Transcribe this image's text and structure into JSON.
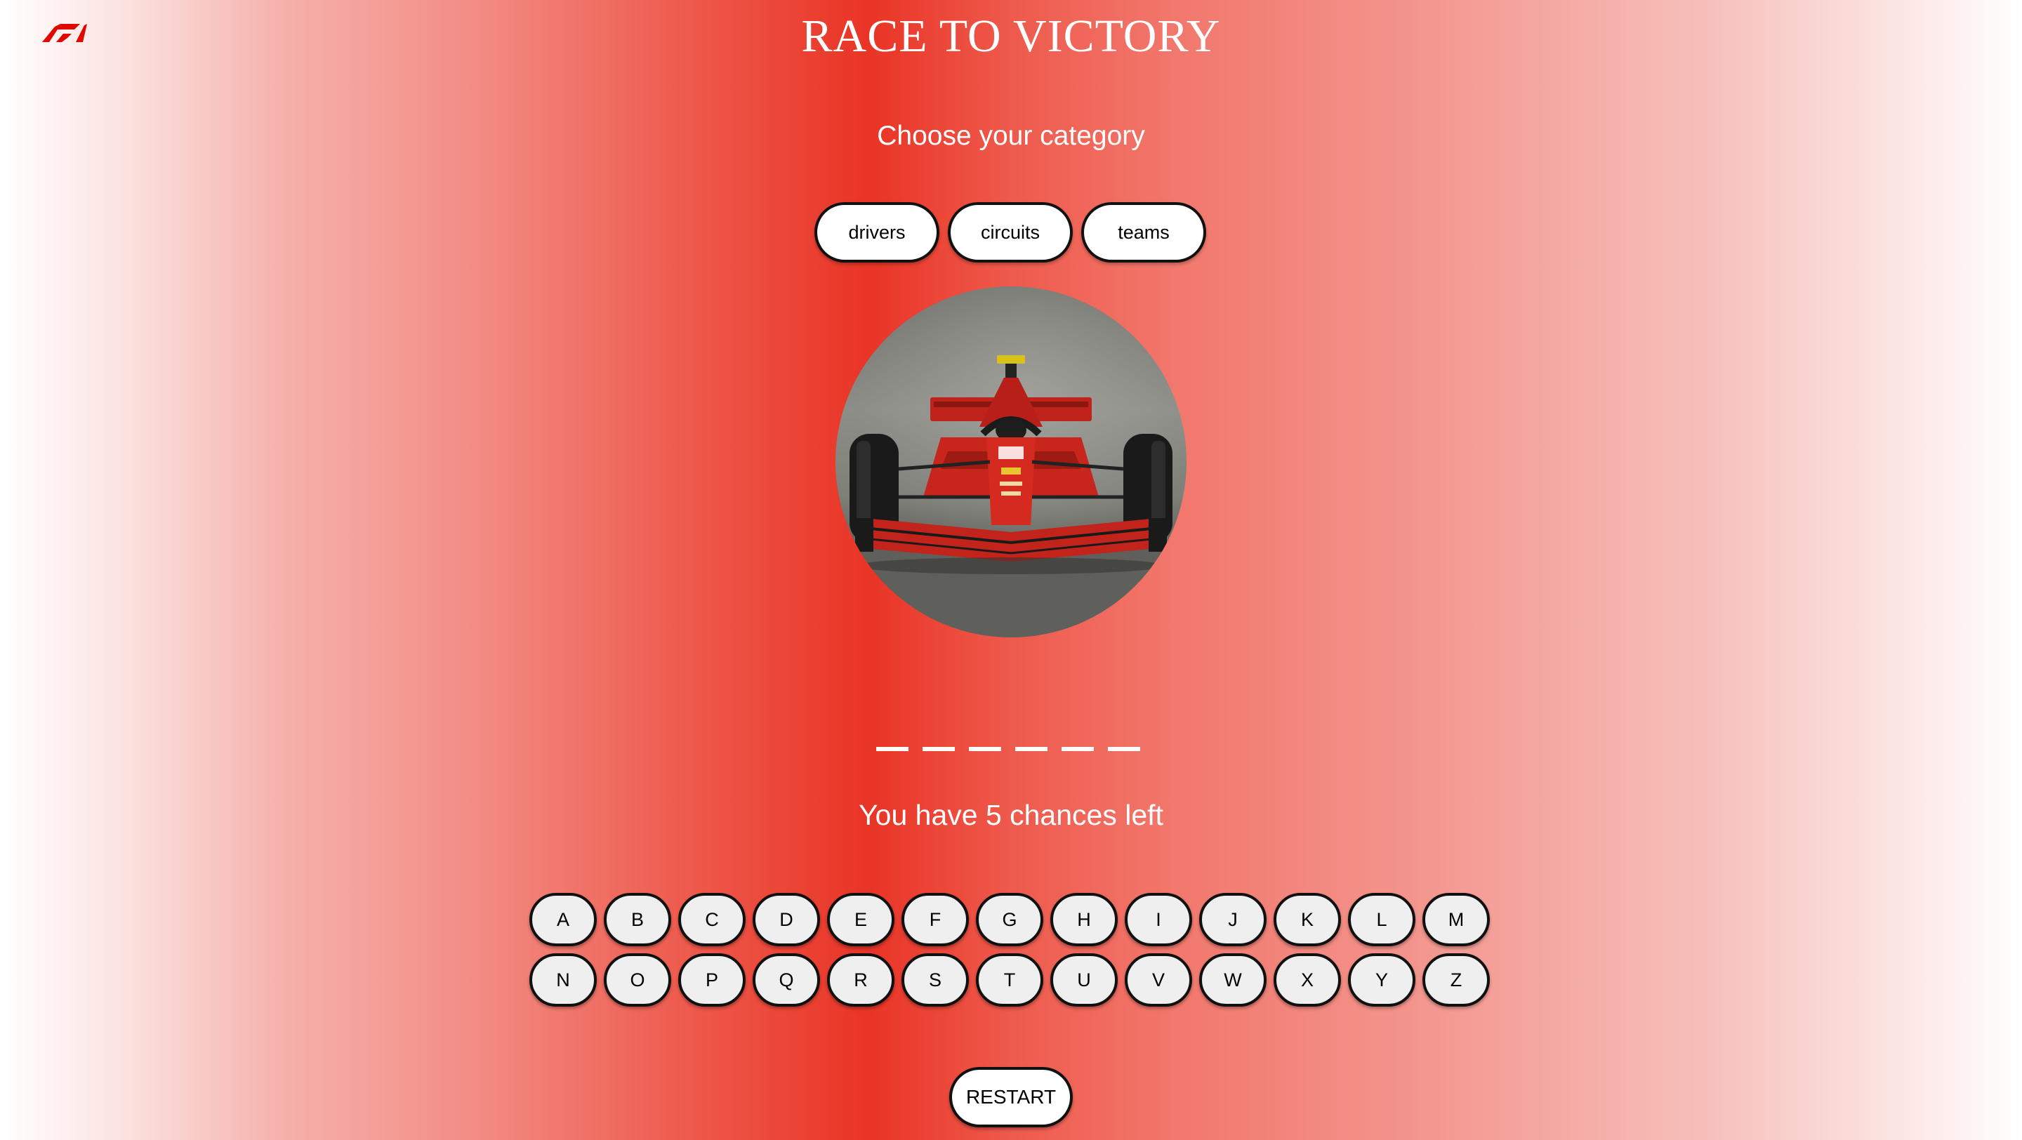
{
  "header": {
    "logo_icon": "f1-logo-icon",
    "title": "RACE TO VICTORY"
  },
  "category": {
    "prompt": "Choose your category",
    "options": [
      "drivers",
      "circuits",
      "teams"
    ]
  },
  "hero_image": {
    "icon": "red-formula-one-car-image"
  },
  "puzzle": {
    "hidden_letter_count": 6,
    "chances_text": "You have 5 chances left"
  },
  "keyboard": {
    "row1": [
      "A",
      "B",
      "C",
      "D",
      "E",
      "F",
      "G",
      "H",
      "I",
      "J",
      "K",
      "L",
      "M"
    ],
    "row2": [
      "N",
      "O",
      "P",
      "Q",
      "R",
      "S",
      "T",
      "U",
      "V",
      "W",
      "X",
      "Y",
      "Z"
    ]
  },
  "controls": {
    "restart_label": "RESTART"
  },
  "colors": {
    "accent": "#e93426",
    "text": "#ffffff",
    "button_bg": "#efefef"
  }
}
